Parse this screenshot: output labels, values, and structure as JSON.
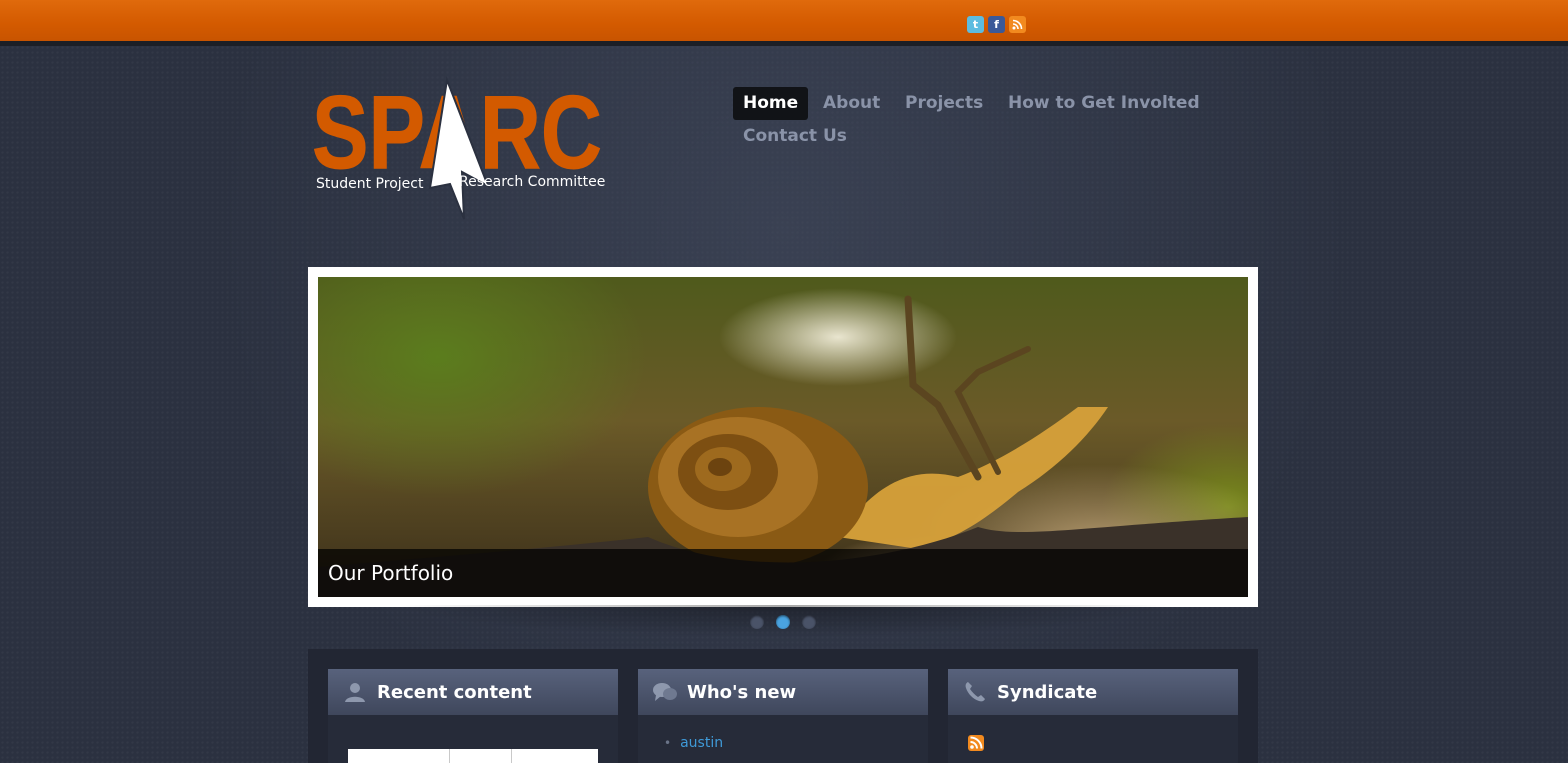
{
  "topbar": {
    "social": [
      {
        "icon": "twitter-icon",
        "glyph": "t"
      },
      {
        "icon": "facebook-icon",
        "glyph": "f"
      },
      {
        "icon": "rss-icon",
        "glyph": ""
      }
    ]
  },
  "logo": {
    "wordmark": "SPARC",
    "left_text": "Student Project",
    "right_text": "Research Committee",
    "colors": {
      "accent": "#d35a00",
      "white": "#ffffff"
    }
  },
  "nav": {
    "items": [
      {
        "label": "Home",
        "active": true
      },
      {
        "label": "About",
        "active": false
      },
      {
        "label": "Projects",
        "active": false
      },
      {
        "label": "How to Get Involted",
        "active": false
      },
      {
        "label": "Contact Us",
        "active": false
      }
    ]
  },
  "slider": {
    "caption": "Our Portfolio",
    "dots": [
      false,
      true,
      false
    ]
  },
  "blocks": [
    {
      "title": "Recent content",
      "icon": "user-icon"
    },
    {
      "title": "Who's new",
      "icon": "chat-bubbles-icon",
      "items": [
        "austin"
      ]
    },
    {
      "title": "Syndicate",
      "icon": "phone-icon"
    }
  ],
  "colors": {
    "orange": "#d35a00",
    "background": "#2b3140",
    "nav_text": "#8a93a8",
    "link": "#3f9ad8"
  }
}
